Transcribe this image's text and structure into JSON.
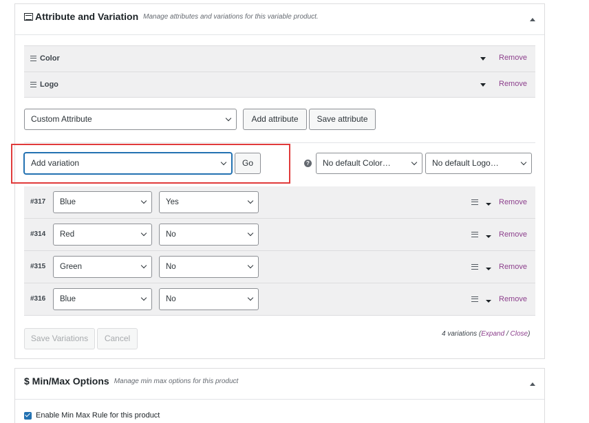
{
  "attributes_panel": {
    "title": "Attribute and Variation",
    "subtitle": "Manage attributes and variations for this variable product.",
    "attributes": [
      {
        "name": "Color",
        "remove_label": "Remove"
      },
      {
        "name": "Logo",
        "remove_label": "Remove"
      }
    ],
    "attribute_select": "Custom Attribute",
    "add_attribute_label": "Add attribute",
    "save_attribute_label": "Save attribute",
    "variation_action_select": "Add variation",
    "go_label": "Go",
    "help_icon": "question-circle-icon",
    "default_color_select": "No default Color…",
    "default_logo_select": "No default Logo…",
    "variations": [
      {
        "id": "#317",
        "color": "Blue",
        "logo": "Yes",
        "remove_label": "Remove"
      },
      {
        "id": "#314",
        "color": "Red",
        "logo": "No",
        "remove_label": "Remove"
      },
      {
        "id": "#315",
        "color": "Green",
        "logo": "No",
        "remove_label": "Remove"
      },
      {
        "id": "#316",
        "color": "Blue",
        "logo": "No",
        "remove_label": "Remove"
      }
    ],
    "save_variations_label": "Save Variations",
    "cancel_label": "Cancel",
    "variation_count_text": "4 variations",
    "expand_label": "Expand",
    "close_label": "Close"
  },
  "minmax_panel": {
    "title": "$ Min/Max Options",
    "subtitle": "Manage min max options for this product",
    "enable_label": "Enable Min Max Rule for this product",
    "enable_checked": true
  },
  "colors": {
    "link": "#8c3f8c",
    "focus": "#2271b1",
    "highlight": "#e03a3a"
  }
}
